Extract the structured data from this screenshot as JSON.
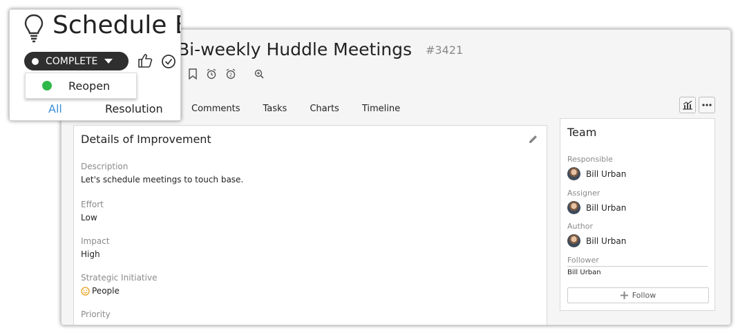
{
  "window": {
    "title": "Bi-weekly Huddle Meetings",
    "id": "#3421",
    "tabs": [
      "Comments",
      "Tasks",
      "Charts",
      "Timeline"
    ]
  },
  "details": {
    "title": "Details of Improvement",
    "fields": [
      {
        "label": "Description",
        "value": "Let's schedule meetings to touch base."
      },
      {
        "label": "Effort",
        "value": "Low"
      },
      {
        "label": "Impact",
        "value": "High"
      },
      {
        "label": "Strategic Initiative",
        "value": "People"
      },
      {
        "label": "Priority",
        "value": ""
      }
    ]
  },
  "team": {
    "title": "Team",
    "responsible_label": "Responsible",
    "responsible": "Bill Urban",
    "assigner_label": "Assigner",
    "assigner": "Bill Urban",
    "author_label": "Author",
    "author": "Bill Urban",
    "follower_label": "Follower",
    "follower": "Bill Urban",
    "follow_button": "Follow"
  },
  "zoom": {
    "title": "Schedule B",
    "status": "COMPLETE",
    "menu_item": "Reopen",
    "tab_all": "All",
    "tab_resolution": "Resolution"
  },
  "colors": {
    "accent": "#3a8fd8",
    "status_bg": "#2f2f2f",
    "reopen_dot": "#2fb84a",
    "emoji": "#e8a020"
  }
}
